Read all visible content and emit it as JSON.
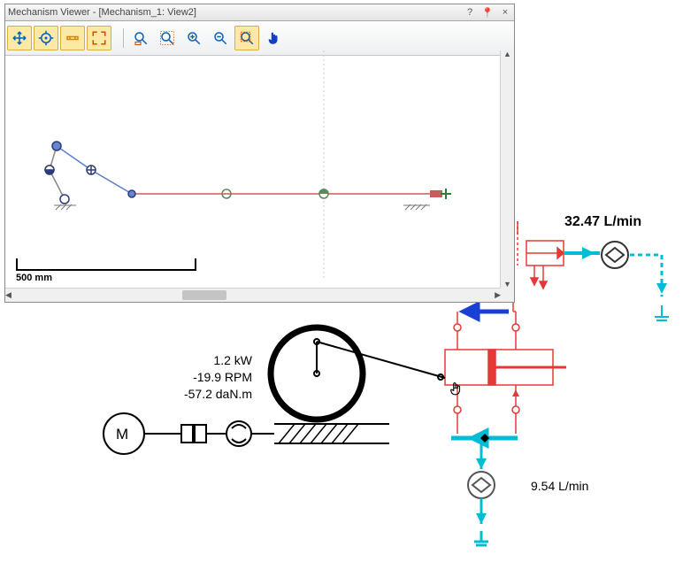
{
  "panel": {
    "title": "Mechanism Viewer - [Mechanism_1: View2]",
    "help_btn": "?",
    "pin_btn": "📌",
    "close_btn": "×"
  },
  "toolbar": {
    "tool_move": "move",
    "tool_target": "target",
    "tool_joint": "joint",
    "tool_fit": "fit",
    "tool_zoominrect": "zoom-rect-in",
    "tool_zoomoutrect": "zoom-rect-out",
    "tool_zoomin": "zoom-in",
    "tool_zoomout": "zoom-out",
    "tool_zoomwindow": "zoom-window",
    "tool_pan": "pan"
  },
  "scale": {
    "label": "500 mm"
  },
  "motor_readout": {
    "power": "1.2 kW",
    "speed": "-19.9 RPM",
    "torque": "-57.2 daN.m"
  },
  "flow_top": "32.47 L/min",
  "flow_bottom": "9.54 L/min",
  "icons": {
    "motor_letter": "M"
  }
}
